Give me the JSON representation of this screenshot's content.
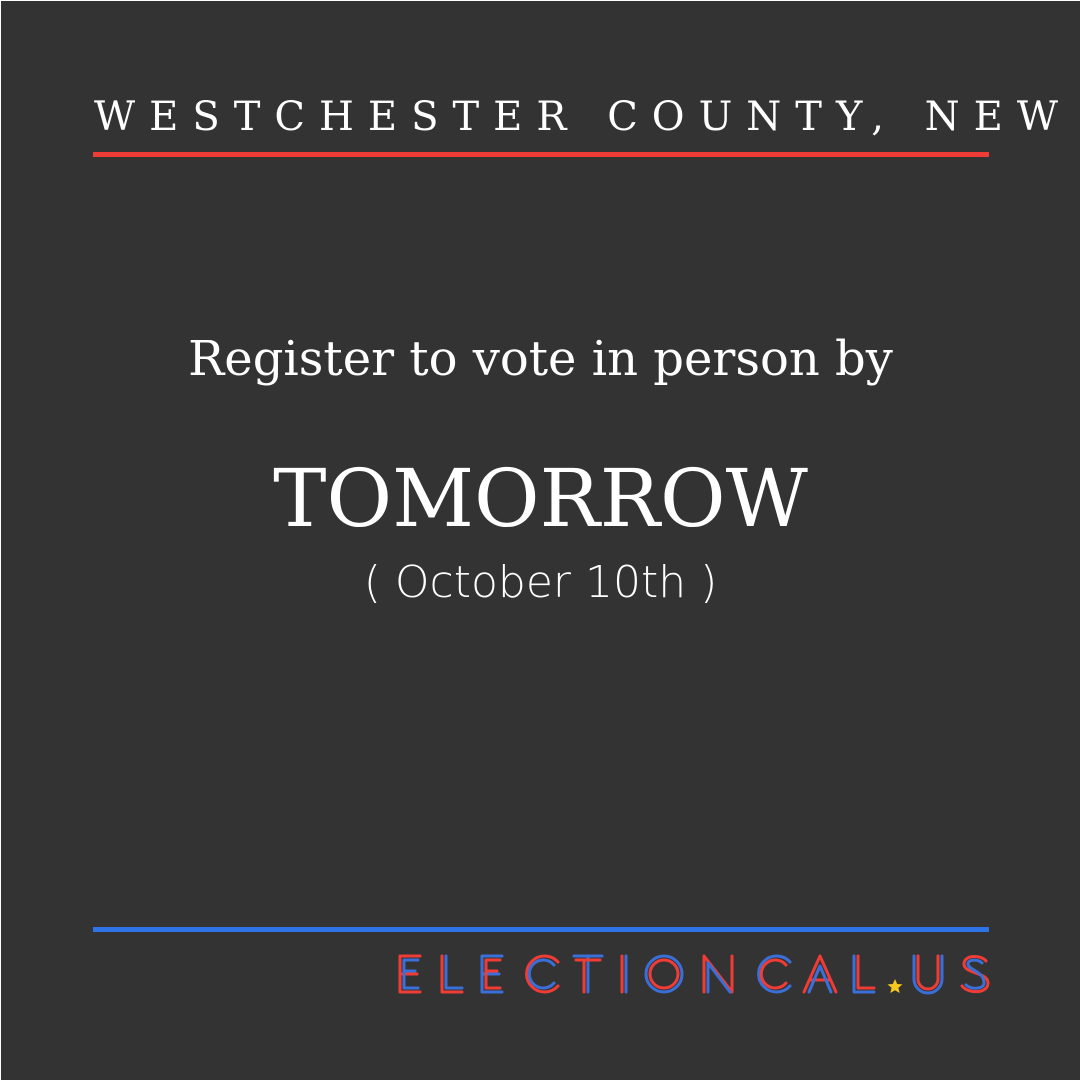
{
  "header": {
    "county": "WESTCHESTER COUNTY, NEW YORK"
  },
  "message": {
    "line1": "Register to vote in person by",
    "deadline": "TOMORROW",
    "date": "( October 10th )"
  },
  "logo": {
    "text": "ELECTIONCAL.US",
    "colors": {
      "red": "#f03c36",
      "blue": "#3b6fd8",
      "star": "#f7c81e"
    }
  },
  "colors": {
    "background": "#333333",
    "top_rule": "#f03c36",
    "bottom_rule": "#2e74e8",
    "text": "#ffffff"
  }
}
